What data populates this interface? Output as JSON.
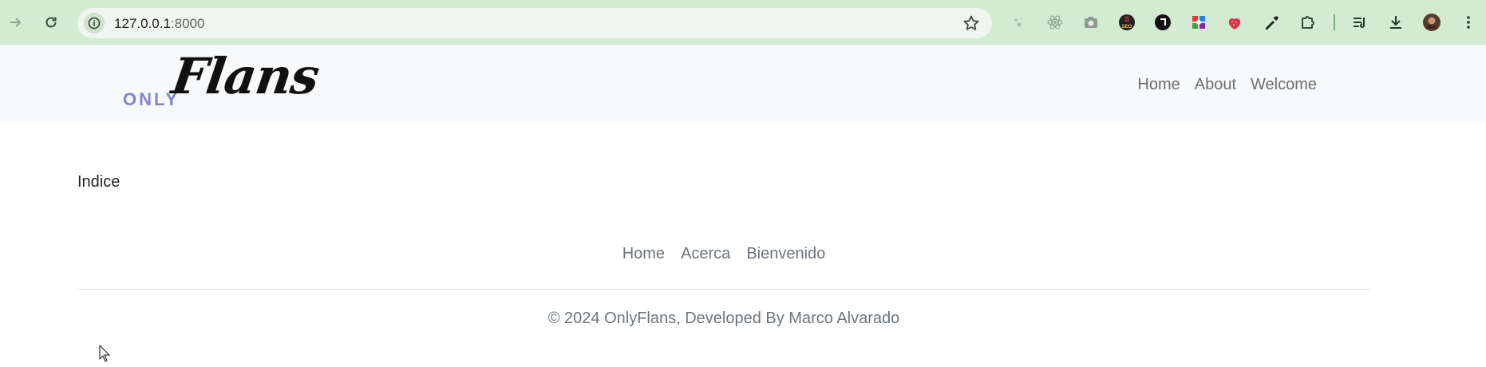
{
  "browser": {
    "url_host": "127.0.0.1",
    "url_port": ":8000",
    "extensions": [
      {
        "icon": "sparkle-extension-icon"
      },
      {
        "icon": "react-extension-icon"
      },
      {
        "icon": "camera-extension-icon"
      },
      {
        "icon": "seo-extension-icon",
        "label": "SEO"
      },
      {
        "icon": "black-circle-extension-icon"
      },
      {
        "icon": "color-grid-extension-icon"
      },
      {
        "icon": "strawberry-extension-icon"
      },
      {
        "icon": "eyedropper-extension-icon"
      },
      {
        "icon": "puzzle-extensions-icon"
      }
    ],
    "colors": {
      "toolbar_bg": "#d3ebd3",
      "omnibox_bg": "#eef6ee"
    }
  },
  "navbar": {
    "brand_prefix": "ONLY",
    "brand_name": "Flans",
    "links": [
      {
        "label": "Home"
      },
      {
        "label": "About"
      },
      {
        "label": "Welcome"
      }
    ]
  },
  "main": {
    "heading": "Indice"
  },
  "footer": {
    "links": [
      {
        "label": "Home"
      },
      {
        "label": "Acerca"
      },
      {
        "label": "Bienvenido"
      }
    ],
    "copyright": "© 2024 OnlyFlans, Developed By Marco Alvarado"
  }
}
